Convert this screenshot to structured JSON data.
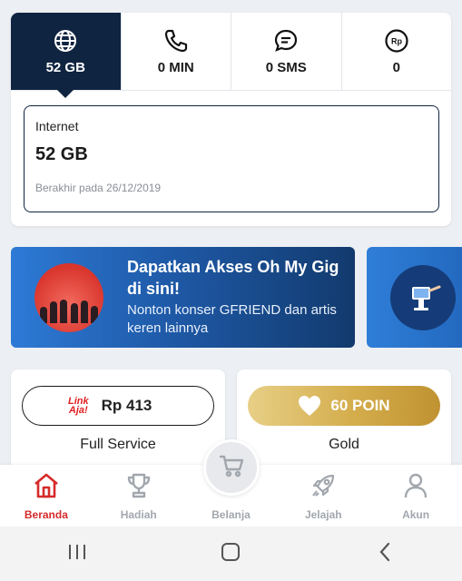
{
  "tabs": [
    {
      "label": "52 GB",
      "icon": "globe-icon"
    },
    {
      "label": "0 MIN",
      "icon": "phone-icon"
    },
    {
      "label": "0 SMS",
      "icon": "chat-icon"
    },
    {
      "label": "0",
      "icon": "rupiah-coin-icon"
    }
  ],
  "detail": {
    "title": "Internet",
    "amount": "52 GB",
    "expiry": "Berakhir pada 26/12/2019"
  },
  "banner": {
    "title": "Dapatkan Akses Oh My Gig di sini!",
    "subtitle": "Nonton konser GFRIEND dan artis keren lainnya"
  },
  "linkaja": {
    "logo_line1": "Link",
    "logo_line2": "Aja!",
    "balance": "Rp 413",
    "caption": "Full Service"
  },
  "points": {
    "value": "60 POIN",
    "caption": "Gold"
  },
  "nav": [
    {
      "label": "Beranda",
      "icon": "home-icon",
      "active": true
    },
    {
      "label": "Hadiah",
      "icon": "trophy-icon"
    },
    {
      "label": "Belanja",
      "icon": "cart-icon"
    },
    {
      "label": "Jelajah",
      "icon": "rocket-icon"
    },
    {
      "label": "Akun",
      "icon": "user-icon"
    }
  ],
  "colors": {
    "navy": "#0f2440",
    "accent_red": "#d62a2a",
    "gold": "#d4ad4c",
    "banner_blue": "#1f5aa8"
  }
}
